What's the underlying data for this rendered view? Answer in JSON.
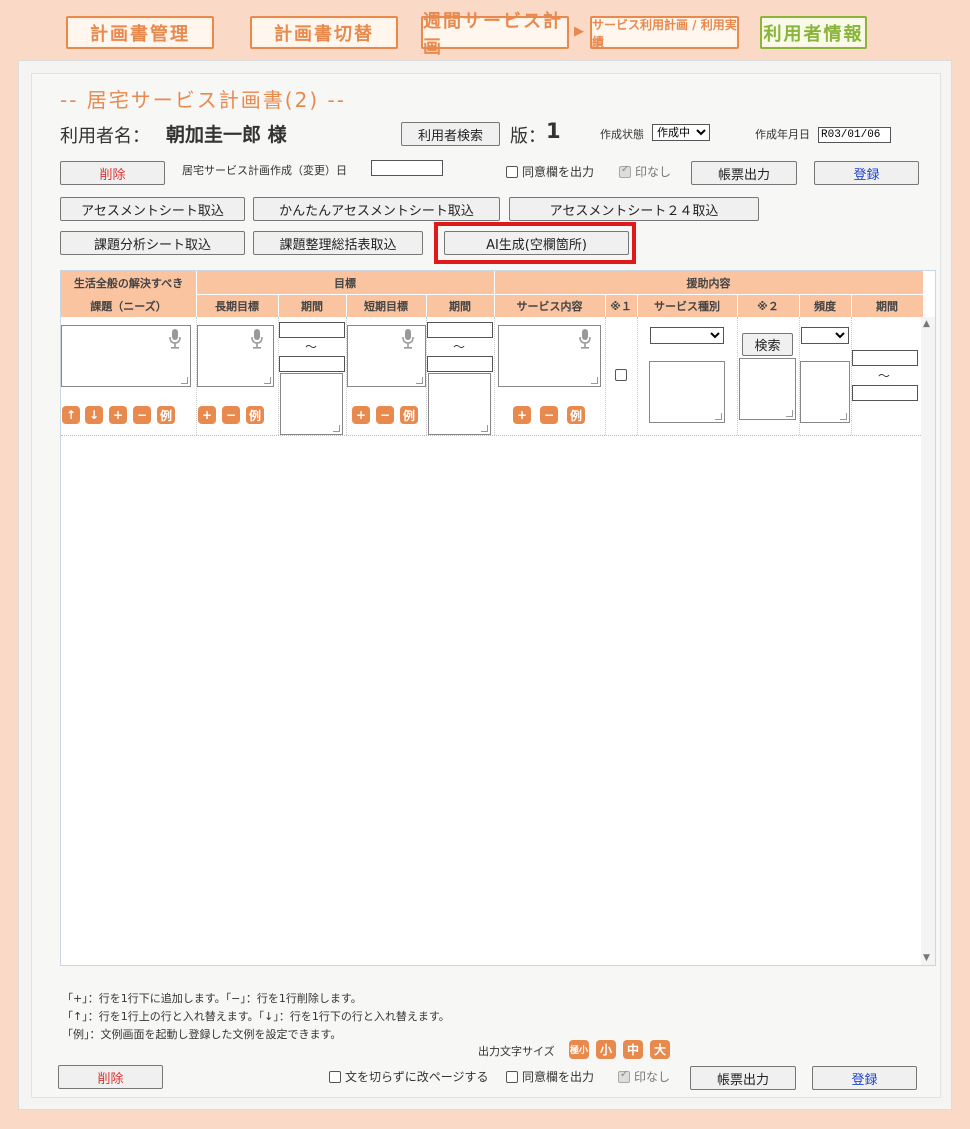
{
  "nav": {
    "items": [
      "計画書管理",
      "計画書切替",
      "週間サービス計画",
      "サービス利用計画 / 利用実績",
      "利用者情報"
    ],
    "arrow": "▶"
  },
  "page": {
    "title": "-- 居宅サービス計画書(2) --",
    "user_label": "利用者名：",
    "user_name": "朝加圭一郎 様",
    "user_search": "利用者検索",
    "version_label": "版：",
    "version": "1",
    "status_label": "作成状態",
    "status_value": "作成中",
    "date_label": "作成年月日",
    "date_value": "R03/01/06",
    "delete": "削除",
    "plan_date_label": "居宅サービス計画作成（変更）日",
    "consent_output": "同意欄を出力",
    "no_stamp": "印なし",
    "print": "帳票出力",
    "register": "登録"
  },
  "import_buttons": {
    "assessment": "アセスメントシート取込",
    "easy_assessment": "かんたんアセスメントシート取込",
    "assessment24": "アセスメントシート２４取込",
    "issue_analysis": "課題分析シート取込",
    "issue_summary": "課題整理総括表取込",
    "ai_generate": "AI生成(空欄箇所)"
  },
  "table": {
    "headers": {
      "needs_top": "生活全般の解決すべき",
      "needs_bottom": "課題（ニーズ）",
      "goals": "目標",
      "long_goal": "長期目標",
      "period1": "期間",
      "short_goal": "短期目標",
      "period2": "期間",
      "support": "援助内容",
      "service_content": "サービス内容",
      "note1": "※１",
      "service_type": "サービス種別",
      "note2": "※２",
      "frequency": "頻度",
      "period3": "期間"
    },
    "tilde": "～",
    "search": "検索",
    "example": "例",
    "plus": "+",
    "minus": "−",
    "up": "↑",
    "down": "↓"
  },
  "notes": [
    "「+」：行を1行下に追加します。「−」：行を1行削除します。",
    "「↑」：行を1行上の行と入れ替えます。「↓」：行を1行下の行と入れ替えます。",
    "「例」：文例画面を起動し登録した文例を設定できます。"
  ],
  "footer": {
    "font_size_label": "出力文字サイズ",
    "sizes": [
      "極小",
      "小",
      "中",
      "大"
    ],
    "delete": "削除",
    "no_break": "文を切らずに改ページする",
    "consent_output": "同意欄を出力",
    "no_stamp": "印なし",
    "print": "帳票出力",
    "register": "登録"
  },
  "colors": {
    "accent": "#e8894e",
    "header": "#fbc4a1",
    "highlight": "#e01a1a",
    "green": "#8ab43a"
  }
}
